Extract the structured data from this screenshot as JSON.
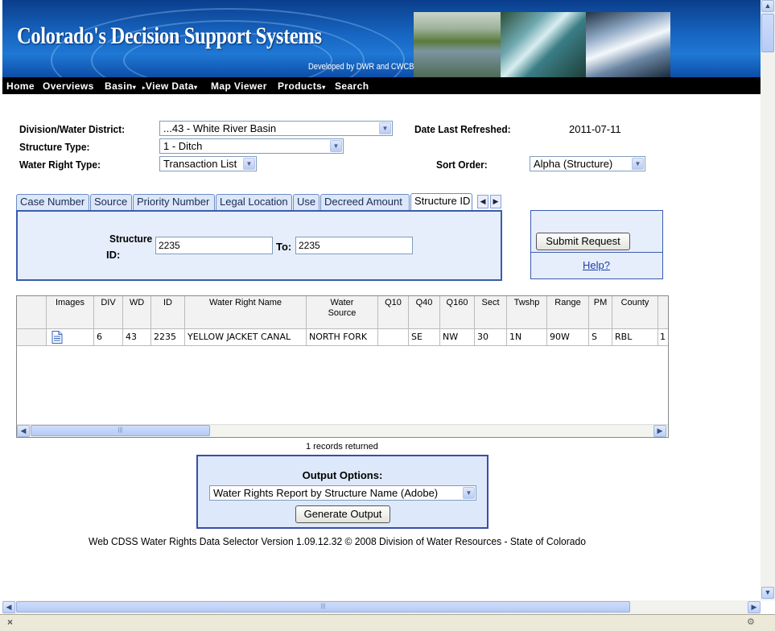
{
  "header": {
    "title": "Colorado's Decision Support Systems",
    "developed_by": "Developed by DWR and CWCB"
  },
  "nav": {
    "items": [
      "Home",
      "Overviews",
      "Basin",
      "View Data",
      "Map Viewer",
      "Products",
      "Search"
    ]
  },
  "form": {
    "division_label": "Division/Water District:",
    "division_value": "...43 - White River Basin",
    "date_label": "Date Last Refreshed:",
    "date_value": "2011-07-11",
    "structure_type_label": "Structure Type:",
    "structure_type_value": "1 - Ditch",
    "water_right_type_label": "Water Right Type:",
    "water_right_type_value": "Transaction List",
    "sort_order_label": "Sort Order:",
    "sort_order_value": "Alpha (Structure)"
  },
  "tabs": [
    "Case Number",
    "Source",
    "Priority Number",
    "Legal Location",
    "Use",
    "Decreed Amount",
    "Structure ID"
  ],
  "tab_panel": {
    "structure_label_1": "Structure",
    "structure_label_2": "ID:",
    "from_value": "2235",
    "to_label": "To:",
    "to_value": "2235"
  },
  "submit": {
    "button": "Submit Request",
    "help": "Help?"
  },
  "grid": {
    "columns": [
      "Images",
      "DIV",
      "WD",
      "ID",
      "Water Right Name",
      "Water Source",
      "Q10",
      "Q40",
      "Q160",
      "Sect",
      "Twshp",
      "Range",
      "PM",
      "County"
    ],
    "rows": [
      [
        "",
        "6",
        "43",
        "2235",
        "YELLOW JACKET CANAL",
        "NORTH FORK",
        "",
        "SE",
        "NW",
        "30",
        "1N",
        "90W",
        "S",
        "RBL",
        "1"
      ]
    ]
  },
  "records_text": "1 records returned",
  "output": {
    "title": "Output Options:",
    "selected": "Water Rights Report by Structure Name (Adobe)",
    "button": "Generate Output"
  },
  "footer": "Web CDSS Water Rights Data Selector Version 1.09.12.32 © 2008 Division of Water Resources - State of Colorado"
}
